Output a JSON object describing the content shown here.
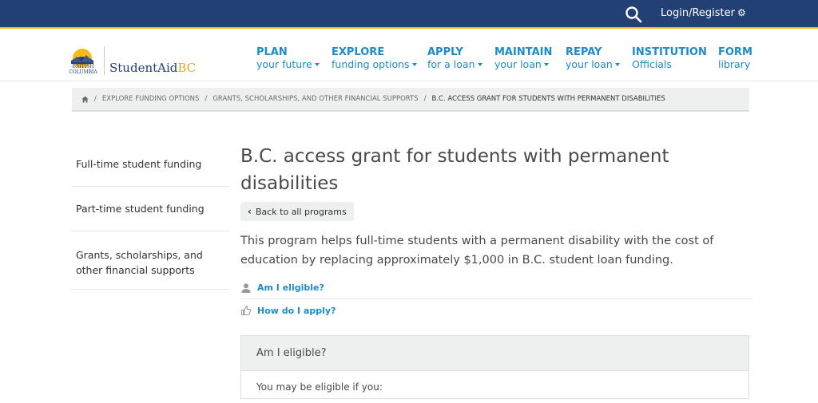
{
  "topbar": {
    "login_label": "Login/Register"
  },
  "logo": {
    "emblem_text": "BRITISH COLUMBIA",
    "brand_main": "StudentAid",
    "brand_accent": "BC"
  },
  "nav": [
    {
      "main": "PLAN",
      "sub": "your future"
    },
    {
      "main": "EXPLORE",
      "sub": "funding options"
    },
    {
      "main": "APPLY",
      "sub": "for a loan"
    },
    {
      "main": "MAINTAIN",
      "sub": "your loan"
    },
    {
      "main": "REPAY",
      "sub": "your loan"
    },
    {
      "main": "INSTITUTION",
      "sub": "Officials"
    },
    {
      "main": "FORM",
      "sub": "library"
    }
  ],
  "breadcrumb": {
    "items": [
      "Explore funding options",
      "Grants, scholarships, and other financial supports"
    ],
    "current": "B.C. access grant for students with permanent disabilities"
  },
  "sidebar": [
    "Full-time student funding",
    "Part-time student funding",
    "Grants, scholarships, and other financial supports"
  ],
  "main": {
    "title": "B.C. access grant for students with permanent disabilities",
    "back_label": "Back to all programs",
    "intro": "This program helps full-time students with a permanent disability with the cost of education by replacing approximately $1,000 in B.C. student loan funding.",
    "anchors": [
      "Am I eligible?",
      "How do I apply?"
    ],
    "panel_title": "Am I eligible?",
    "panel_text": "You may be eligible if you:"
  },
  "colors": {
    "topbar": "#234075",
    "accent": "#fcba19",
    "link": "#1e8ac8"
  }
}
